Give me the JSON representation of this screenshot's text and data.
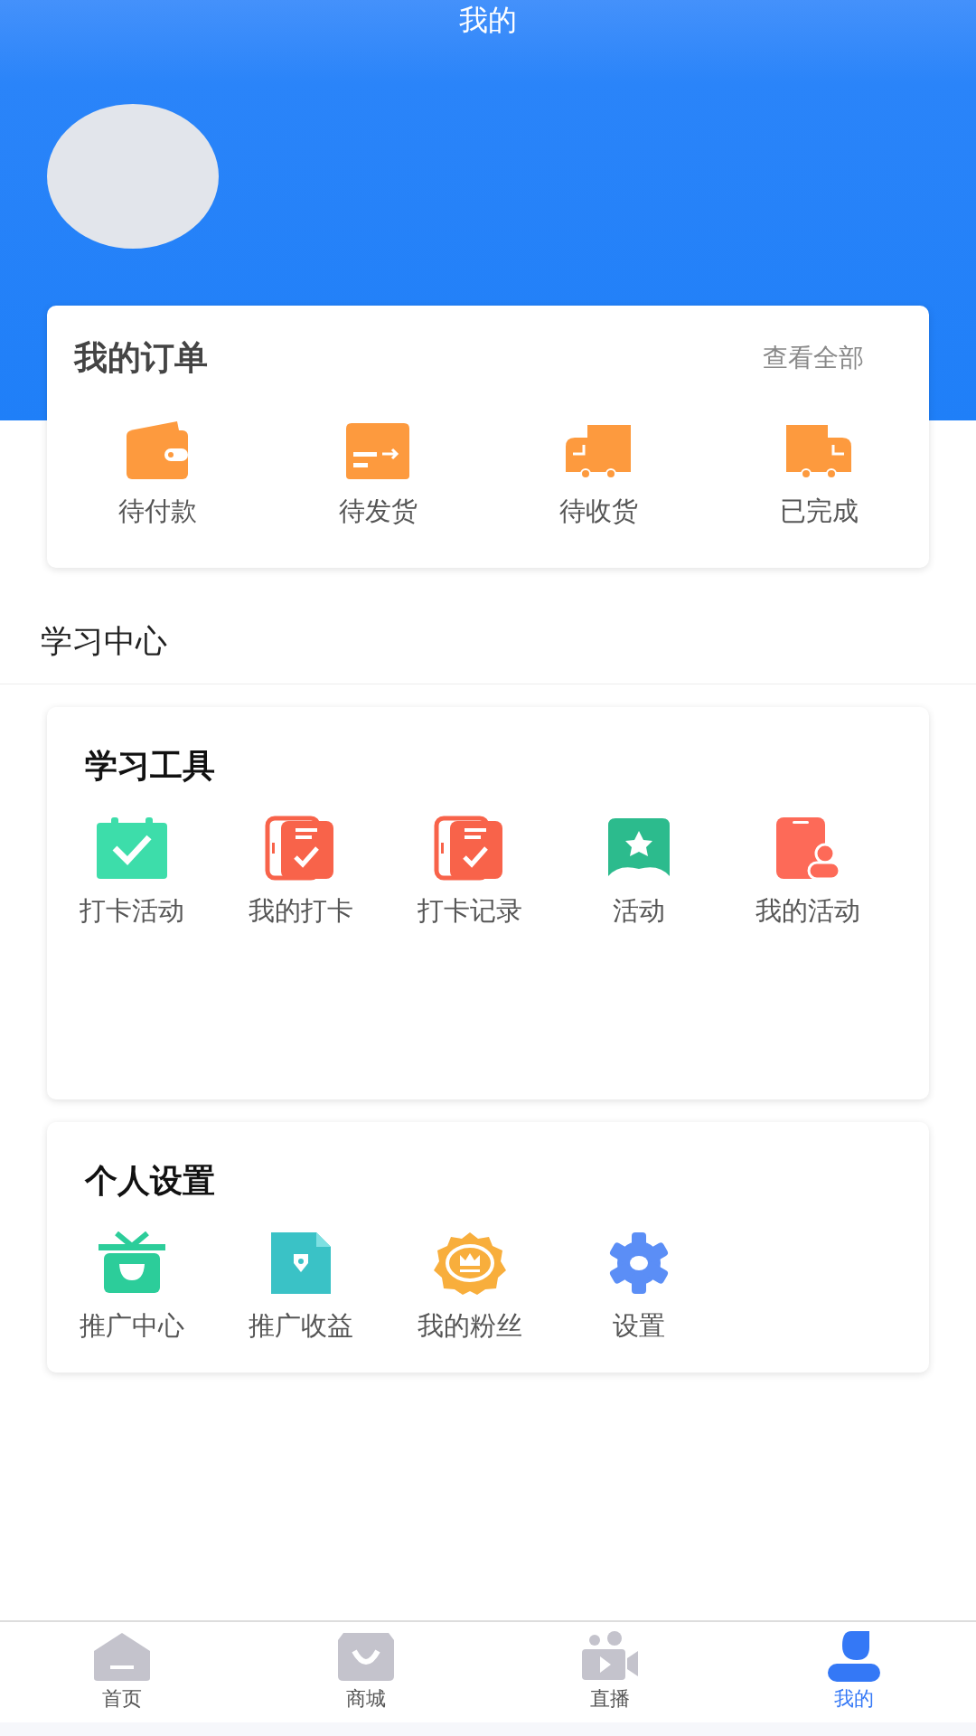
{
  "header": {
    "title": "我的"
  },
  "orders": {
    "title": "我的订单",
    "link": "查看全部",
    "items": [
      {
        "label": "待付款"
      },
      {
        "label": "待发货"
      },
      {
        "label": "待收货"
      },
      {
        "label": "已完成"
      }
    ]
  },
  "section_title": "学习中心",
  "panels": [
    {
      "title": "学习工具",
      "items": [
        {
          "label": "打卡活动"
        },
        {
          "label": "我的打卡"
        },
        {
          "label": "打卡记录"
        },
        {
          "label": "活动"
        },
        {
          "label": "我的活动"
        }
      ]
    },
    {
      "title": "个人设置",
      "items": [
        {
          "label": "推广中心"
        },
        {
          "label": "推广收益"
        },
        {
          "label": "我的粉丝"
        },
        {
          "label": "设置"
        }
      ]
    }
  ],
  "tab_bar": [
    {
      "label": "首页",
      "selected": false
    },
    {
      "label": "商城",
      "selected": false
    },
    {
      "label": "直播",
      "selected": false
    },
    {
      "label": "我的",
      "selected": true
    }
  ]
}
